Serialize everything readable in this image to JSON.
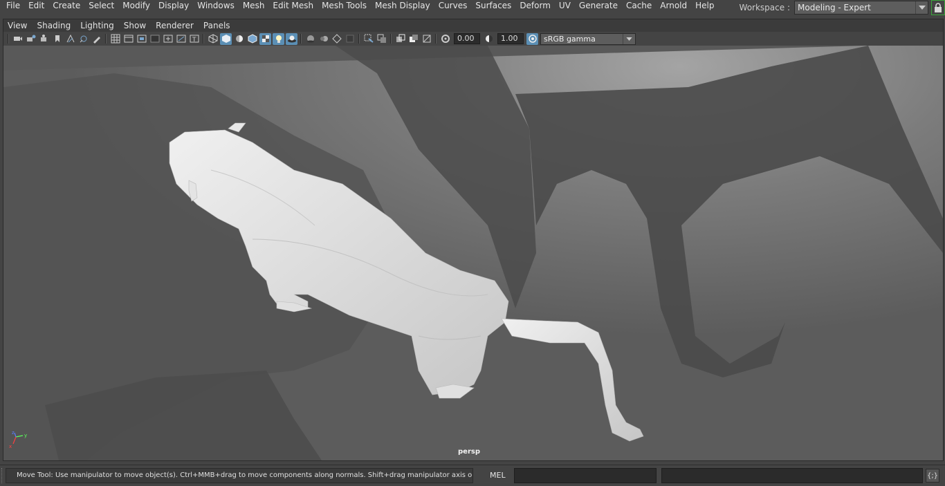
{
  "menubar": {
    "items": [
      "File",
      "Edit",
      "Create",
      "Select",
      "Modify",
      "Display",
      "Windows",
      "Mesh",
      "Edit Mesh",
      "Mesh Tools",
      "Mesh Display",
      "Curves",
      "Surfaces",
      "Deform",
      "UV",
      "Generate",
      "Cache",
      "Arnold",
      "Help"
    ]
  },
  "workspace": {
    "label": "Workspace :",
    "value": "Modeling - Expert"
  },
  "panel_menu": {
    "items": [
      "View",
      "Shading",
      "Lighting",
      "Show",
      "Renderer",
      "Panels"
    ]
  },
  "toolbar": {
    "exposure": "0.00",
    "gamma": "1.00",
    "color_space": "sRGB gamma"
  },
  "viewport": {
    "camera_label": "persp",
    "axis_x": "x",
    "axis_y": "y",
    "axis_z": "z"
  },
  "statusbar": {
    "help_line": "Move Tool: Use manipulator to move object(s). Ctrl+MMB+drag to move components along normals. Shift+drag manipulator axis or plane handles to",
    "mel_label": "MEL",
    "script_editor_icon": "{;}"
  },
  "colors": {
    "accent": "#5b8fb5",
    "lock_border": "#3aa63a",
    "ui_bg": "#444444"
  }
}
